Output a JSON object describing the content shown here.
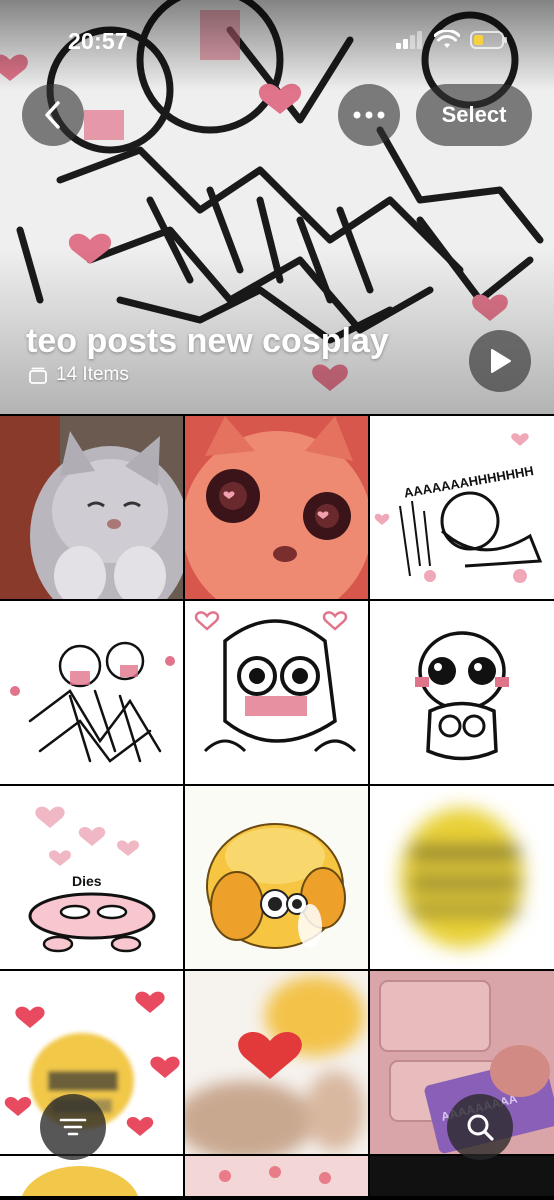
{
  "status_bar": {
    "time": "20:57",
    "icons": [
      "cellular-signal-icon",
      "wifi-icon",
      "battery-low-icon"
    ]
  },
  "nav": {
    "back_icon": "chevron-left-icon",
    "more_icon": "ellipsis-icon",
    "select_label": "Select"
  },
  "album": {
    "title": "teo posts new cosplay",
    "count_text": "14 Items",
    "count_icon": "stack-icon",
    "play_icon": "play-icon"
  },
  "grid": {
    "tiles": [
      {
        "name": "photo-grey-cat-smiling"
      },
      {
        "name": "photo-red-tinted-cat-stare"
      },
      {
        "name": "photo-stick-figure-screaming",
        "caption": "AAAAAAAHHHHHHH"
      },
      {
        "name": "photo-stick-figure-scribbles"
      },
      {
        "name": "photo-stick-figure-blushing-hearts"
      },
      {
        "name": "photo-stick-figure-shy"
      },
      {
        "name": "photo-dies-doodle",
        "caption": "Dies"
      },
      {
        "name": "photo-emoji-covering-face"
      },
      {
        "name": "photo-blurry-emoji"
      },
      {
        "name": "photo-emoji-hearts"
      },
      {
        "name": "photo-blurry-heart-emoji"
      },
      {
        "name": "photo-pink-keyboard",
        "caption": "AAAAAAAAA"
      },
      {
        "name": "photo-partial-emoji"
      },
      {
        "name": "photo-partial-pink"
      },
      {
        "name": "photo-partial-dark"
      }
    ]
  },
  "floating": {
    "filter_icon": "sort-lines-icon",
    "search_icon": "search-icon"
  },
  "colors": {
    "accent_pink": "#e8808e",
    "battery_yellow": "#f5d142"
  }
}
